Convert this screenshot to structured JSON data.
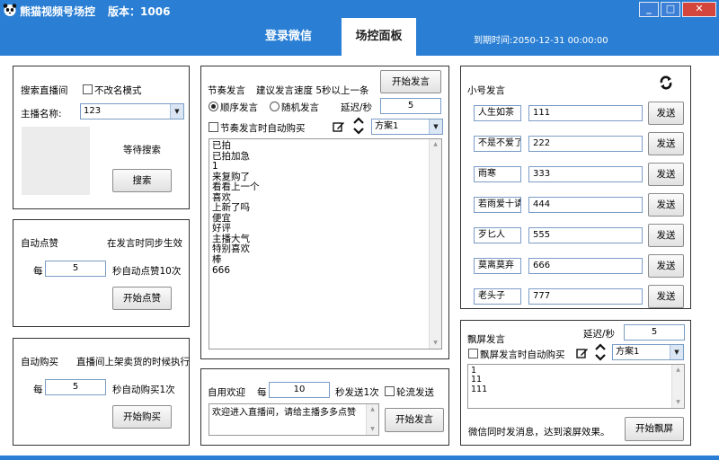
{
  "window": {
    "title": "熊猫视频号场控",
    "version": "版本：1006",
    "min": "_",
    "max": "□",
    "close": "✕"
  },
  "nav": {
    "tabs": [
      {
        "label": "登录微信"
      },
      {
        "label": "场控面板"
      }
    ],
    "expire": "到期时间:2050-12-31 00:00:00"
  },
  "search": {
    "title": "搜索直播间",
    "keep_name_label": "不改名模式",
    "anchor_label": "主播名称:",
    "anchor_value": "123",
    "status": "等待搜索",
    "search_button": "搜索"
  },
  "autolike": {
    "title": "自动点赞",
    "sync_note": "在发言时同步生效",
    "every": "每",
    "interval": "5",
    "suffix": "秒自动点赞10次",
    "start_button": "开始点赞"
  },
  "autobuy": {
    "title": "自动购买",
    "note": "直播间上架卖货的时候执行",
    "every": "每",
    "interval": "5",
    "suffix": "秒自动购买1次",
    "start_button": "开始购买"
  },
  "rhythm": {
    "title": "节奏发言",
    "speed_hint": "建议发言速度 5秒以上一条",
    "start_button": "开始发言",
    "order_label": "顺序发言",
    "random_label": "随机发言",
    "delay_label": "延迟/秒",
    "delay_value": "5",
    "autobuy_label": "节奏发言时自动购买",
    "scheme": "方案1",
    "lines": [
      "已拍",
      "已拍加急",
      "1",
      "来复购了",
      "看看上一个",
      "喜欢",
      "上新了吗",
      "便宜",
      "好评",
      "主播大气",
      "特别喜欢",
      "棒",
      "666"
    ]
  },
  "welcome": {
    "title": "自用欢迎",
    "every": "每",
    "interval": "10",
    "suffix": "秒发送1次",
    "rotate_label": "轮流发送",
    "message": "欢迎进入直播间，请给主播多多点赞",
    "start_button": "开始发言"
  },
  "alt": {
    "title": "小号发言",
    "refresh_icon": "refresh-icon",
    "send_label": "发送",
    "accounts": [
      {
        "name": "人生如茶",
        "message": "111"
      },
      {
        "name": "不是不爱了",
        "message": "222"
      },
      {
        "name": "雨寒",
        "message": "333"
      },
      {
        "name": "若雨爱十请",
        "message": "444"
      },
      {
        "name": "歹匕人",
        "message": "555"
      },
      {
        "name": "莫离莫弃",
        "message": "666"
      },
      {
        "name": "老头子",
        "message": "777"
      }
    ]
  },
  "flood": {
    "title": "飘屏发言",
    "delay_label": "延迟/秒",
    "delay_value": "5",
    "autobuy_label": "飘屏发言时自动购买",
    "scheme": "方案1",
    "lines": [
      "1",
      "11",
      "111"
    ],
    "note": "微信同时发消息，达到滚屏效果。",
    "start_button": "开始飘屏"
  }
}
